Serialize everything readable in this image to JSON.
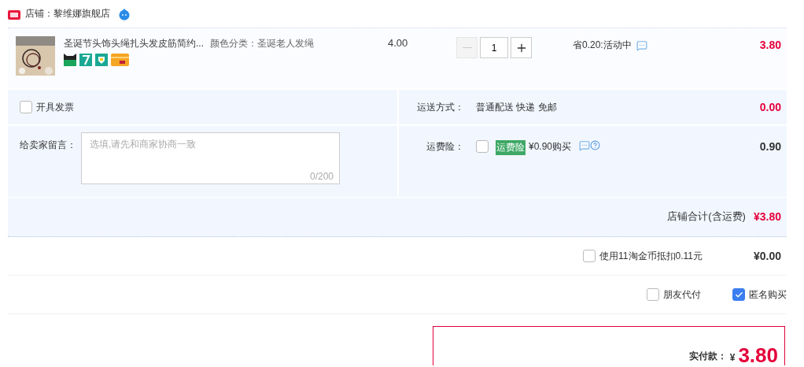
{
  "shop": {
    "name": "店铺：黎维娜旗舰店"
  },
  "item": {
    "title": "圣诞节头饰头绳扎头发皮筋简约...",
    "sku": "颜色分类：圣诞老人发绳",
    "price": "4.00",
    "quantity": "1",
    "decrease_disabled": true,
    "promo": "省0.20:活动中",
    "total": "3.80"
  },
  "invoice": {
    "label": "开具发票",
    "checked": false
  },
  "message": {
    "label": "给卖家留言：",
    "placeholder": "选填,请先和商家协商一致",
    "counter": "0/200"
  },
  "shipping": {
    "label": "运送方式：",
    "method": "普通配送 快递 免邮",
    "fee": "0.00"
  },
  "insurance": {
    "label": "运费险：",
    "checked": false,
    "tag": "运费险",
    "offer": "¥0.90购买",
    "fee": "0.90"
  },
  "shop_total": {
    "label": "店铺合计(含运费)",
    "amount": "¥3.80"
  },
  "coins": {
    "label": "使用11淘金币抵扣0.11元",
    "checked": false,
    "amount": "¥0.00"
  },
  "options": [
    {
      "label": "朋友代付",
      "checked": false
    },
    {
      "label": "匿名购买",
      "checked": true
    }
  ],
  "payment": {
    "label": "实付款：",
    "currency": "¥",
    "amount": "3.80"
  }
}
